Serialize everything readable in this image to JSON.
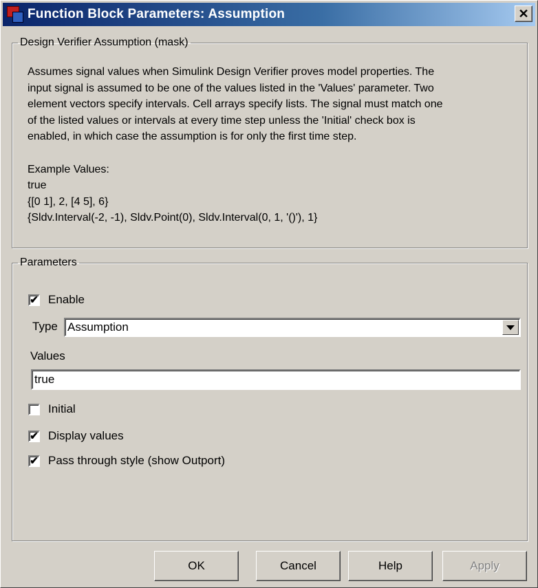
{
  "window": {
    "title": "Function Block Parameters: Assumption",
    "close_label": "✕"
  },
  "mask_group": {
    "legend": "Design Verifier Assumption (mask)",
    "description": [
      "Assumes signal values when Simulink Design Verifier proves model properties.  The",
      "input signal is assumed to be one of the values listed in the 'Values' parameter.  Two",
      "element vectors specify intervals.  Cell arrays specify lists. The signal must match one",
      "of the listed values or intervals at every time step unless the 'Initial' check box is",
      "enabled, in which case the assumption is for only the first time step."
    ],
    "examples_heading": "Example Values:",
    "examples": [
      "true",
      "{[0 1], 2, [4 5], 6}",
      "{Sldv.Interval(-2, -1), Sldv.Point(0), Sldv.Interval(0, 1, '()'), 1}"
    ]
  },
  "parameters": {
    "legend": "Parameters",
    "enable": {
      "label": "Enable",
      "checked": true
    },
    "type": {
      "label": "Type",
      "value": "Assumption"
    },
    "values": {
      "label": "Values",
      "value": "true"
    },
    "initial": {
      "label": "Initial",
      "checked": false
    },
    "display_values": {
      "label": "Display values",
      "checked": true
    },
    "pass_through": {
      "label": "Pass through style (show Outport)",
      "checked": true
    }
  },
  "buttons": {
    "ok": "OK",
    "cancel": "Cancel",
    "help": "Help",
    "apply": "Apply"
  },
  "check_glyph": "✔"
}
